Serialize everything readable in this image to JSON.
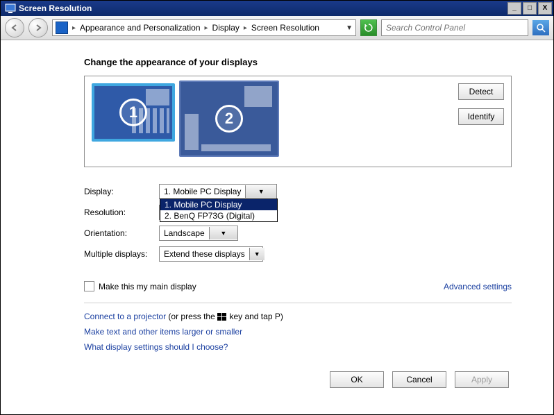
{
  "window": {
    "title": "Screen Resolution"
  },
  "titlebar_buttons": {
    "min": "_",
    "max": "□",
    "close": "X"
  },
  "breadcrumb": {
    "root_icon": "monitor-icon",
    "items": [
      "Appearance and Personalization",
      "Display",
      "Screen Resolution"
    ]
  },
  "search": {
    "placeholder": "Search Control Panel"
  },
  "heading": "Change the appearance of your displays",
  "preview": {
    "monitors": [
      {
        "number": "1"
      },
      {
        "number": "2"
      }
    ],
    "buttons": {
      "detect": "Detect",
      "identify": "Identify"
    }
  },
  "form": {
    "display": {
      "label": "Display:",
      "value": "1. Mobile PC Display",
      "options": [
        "1. Mobile PC Display",
        "2. BenQ FP73G (Digital)"
      ],
      "selected_index": 0
    },
    "resolution": {
      "label": "Resolution:",
      "value": ""
    },
    "orientation": {
      "label": "Orientation:",
      "value": "Landscape"
    },
    "multiple": {
      "label": "Multiple displays:",
      "value": "Extend these displays"
    }
  },
  "main_display": {
    "label": "Make this my main display",
    "checked": false
  },
  "advanced": "Advanced settings",
  "links": {
    "projector_pre": "Connect to a projector",
    "projector_post": " (or press the ",
    "projector_tail": " key and tap P)",
    "text_size": "Make text and other items larger or smaller",
    "which": "What display settings should I choose?"
  },
  "footer": {
    "ok": "OK",
    "cancel": "Cancel",
    "apply": "Apply"
  }
}
